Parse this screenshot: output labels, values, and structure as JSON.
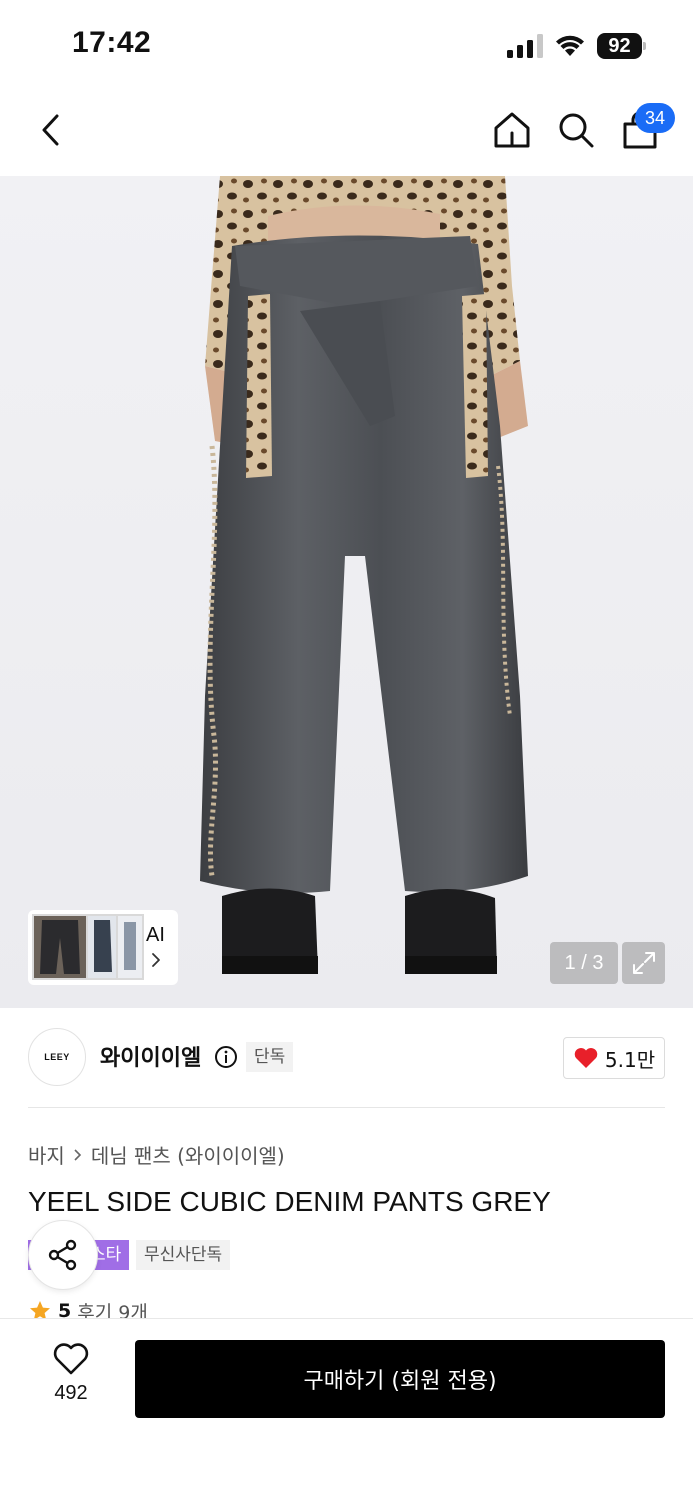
{
  "status_bar": {
    "time": "17:42",
    "battery": "92",
    "icons": [
      "signal-icon",
      "wifi-icon",
      "battery-icon"
    ]
  },
  "nav": {
    "icons": [
      "back-chevron-icon",
      "home-icon",
      "search-icon",
      "shopping-bag-icon"
    ],
    "cart_count": "34"
  },
  "gallery": {
    "thumbnail_label": "AI",
    "page_indicator": "1 / 3",
    "icons": [
      "chevron-right-icon",
      "expand-icon"
    ]
  },
  "brand": {
    "logo_text": "LEEY",
    "name": "와이이이엘",
    "exclusive_badge": "단독",
    "like_count": "5.1만",
    "icons": [
      "info-icon",
      "heart-filled-icon"
    ]
  },
  "product": {
    "breadcrumb": [
      "바지",
      "데님 팬츠 (와이이이엘)"
    ],
    "title": "YEEL SIDE CUBIC DENIM PANTS GREY",
    "tags": [
      "스타",
      "무신사단독"
    ],
    "rating": "5",
    "review_label": "후기 9개"
  },
  "bottom_bar": {
    "wish_count": "492",
    "buy_label": "구매하기 (회원 전용)",
    "icons": [
      "heart-outline-icon",
      "share-icon",
      "star-icon"
    ]
  },
  "colors": {
    "accent_blue": "#1a6cf6",
    "heart_red": "#e8202a",
    "tag_purple": "#a06ee6",
    "star_orange": "#f5a623",
    "buy_button": "#000000"
  }
}
